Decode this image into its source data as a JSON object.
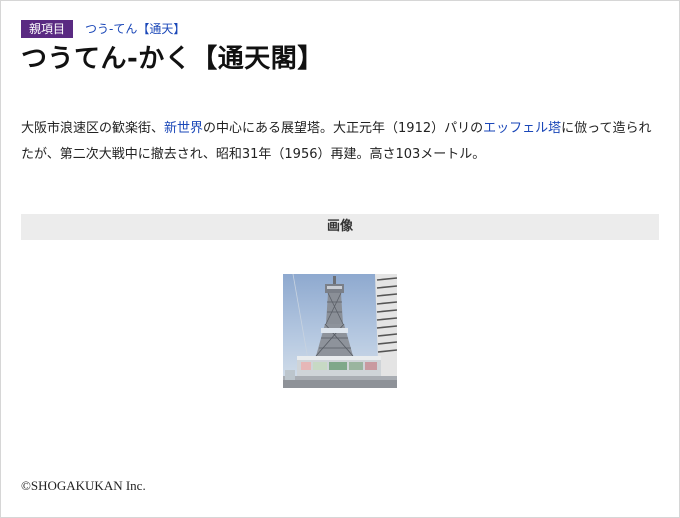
{
  "parent": {
    "badge_label": "親項目",
    "link_text": "つう‐てん【通天】"
  },
  "entry": {
    "headword": "つうてん‐かく【通天閣】",
    "definition": {
      "part1": "大阪市浪速区の歓楽街、",
      "link1": "新世界",
      "part2": "の中心にある展望塔。大正元年（1912）パリの",
      "link2": "エッフェル塔",
      "part3": "に倣って造られたが、第二次大戦中に撤去され、昭和31年（1956）再建。高さ103メートル。"
    }
  },
  "image_section": {
    "header": "画像"
  },
  "colors": {
    "badge_bg": "#5a2a82",
    "link": "#1a47b8",
    "section_header_bg": "#ececec"
  },
  "footer": {
    "copyright": "©SHOGAKUKAN Inc."
  }
}
